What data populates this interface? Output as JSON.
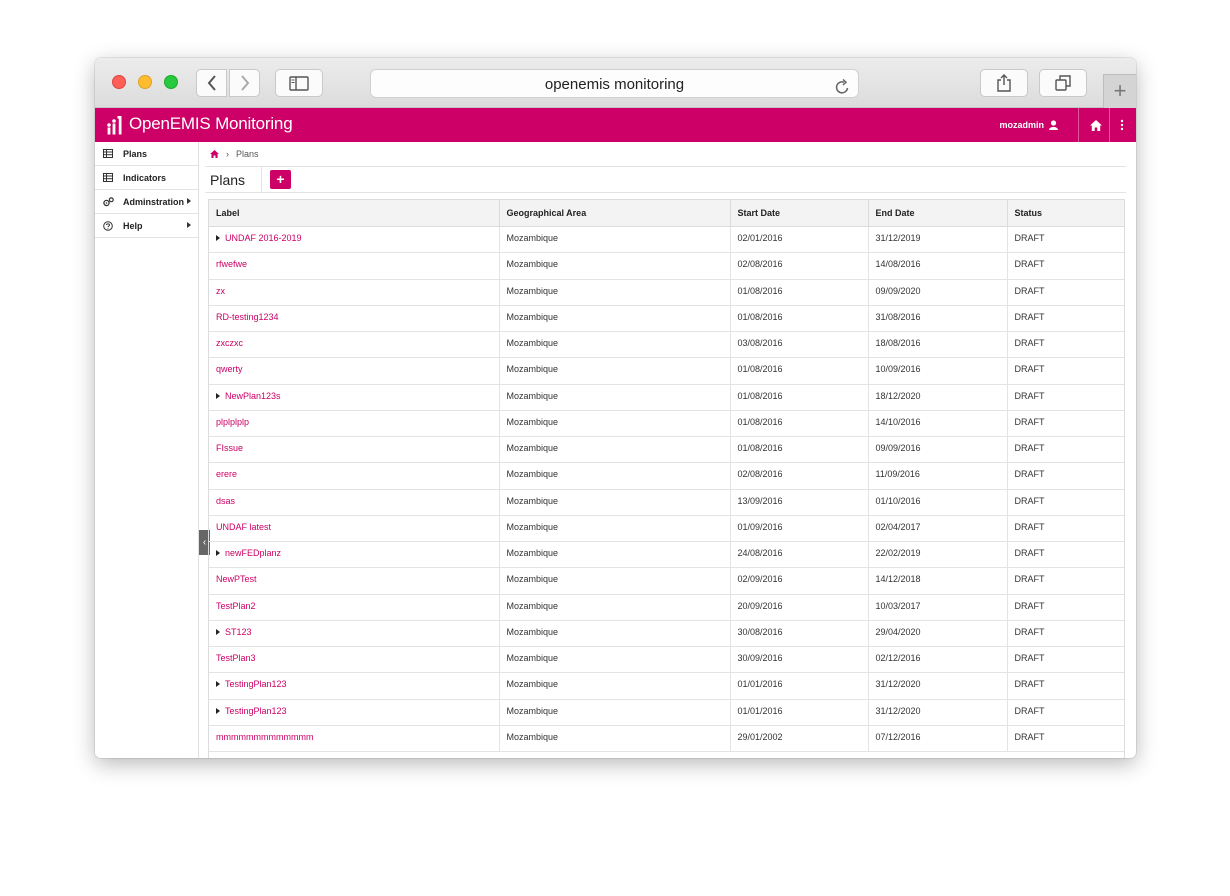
{
  "browser": {
    "url_text": "openemis monitoring",
    "new_tab_glyph": "+"
  },
  "app": {
    "brand": "OpenEMIS Monitoring",
    "user": "mozadmin",
    "accent": "#cc0066"
  },
  "sidebar": {
    "items": [
      {
        "label": "Plans",
        "icon": "table-icon",
        "has_caret": false
      },
      {
        "label": "Indicators",
        "icon": "table-icon",
        "has_caret": false
      },
      {
        "label": "Adminstration",
        "icon": "gears-icon",
        "has_caret": true
      },
      {
        "label": "Help",
        "icon": "help-icon",
        "has_caret": true
      }
    ],
    "collapse_glyph": "‹"
  },
  "breadcrumb": {
    "sep": "›",
    "current": "Plans"
  },
  "page": {
    "title": "Plans",
    "add_label": "+"
  },
  "table": {
    "headers": [
      "Label",
      "Geographical Area",
      "Start Date",
      "End Date",
      "Status"
    ],
    "rows": [
      {
        "label": "UNDAF 2016-2019",
        "expandable": true,
        "area": "Mozambique",
        "start": "02/01/2016",
        "end": "31/12/2019",
        "status": "DRAFT"
      },
      {
        "label": "rfwefwe",
        "expandable": false,
        "area": "Mozambique",
        "start": "02/08/2016",
        "end": "14/08/2016",
        "status": "DRAFT"
      },
      {
        "label": "zx",
        "expandable": false,
        "area": "Mozambique",
        "start": "01/08/2016",
        "end": "09/09/2020",
        "status": "DRAFT"
      },
      {
        "label": "RD-testing1234",
        "expandable": false,
        "area": "Mozambique",
        "start": "01/08/2016",
        "end": "31/08/2016",
        "status": "DRAFT"
      },
      {
        "label": "zxczxc",
        "expandable": false,
        "area": "Mozambique",
        "start": "03/08/2016",
        "end": "18/08/2016",
        "status": "DRAFT"
      },
      {
        "label": "qwerty",
        "expandable": false,
        "area": "Mozambique",
        "start": "01/08/2016",
        "end": "10/09/2016",
        "status": "DRAFT"
      },
      {
        "label": "NewPlan123s",
        "expandable": true,
        "area": "Mozambique",
        "start": "01/08/2016",
        "end": "18/12/2020",
        "status": "DRAFT"
      },
      {
        "label": "plplplplp",
        "expandable": false,
        "area": "Mozambique",
        "start": "01/08/2016",
        "end": "14/10/2016",
        "status": "DRAFT"
      },
      {
        "label": "FIssue",
        "expandable": false,
        "area": "Mozambique",
        "start": "01/08/2016",
        "end": "09/09/2016",
        "status": "DRAFT"
      },
      {
        "label": "erere",
        "expandable": false,
        "area": "Mozambique",
        "start": "02/08/2016",
        "end": "11/09/2016",
        "status": "DRAFT"
      },
      {
        "label": "dsas",
        "expandable": false,
        "area": "Mozambique",
        "start": "13/09/2016",
        "end": "01/10/2016",
        "status": "DRAFT"
      },
      {
        "label": "UNDAF latest",
        "expandable": false,
        "area": "Mozambique",
        "start": "01/09/2016",
        "end": "02/04/2017",
        "status": "DRAFT"
      },
      {
        "label": "newFEDplanz",
        "expandable": true,
        "area": "Mozambique",
        "start": "24/08/2016",
        "end": "22/02/2019",
        "status": "DRAFT"
      },
      {
        "label": "NewPTest",
        "expandable": false,
        "area": "Mozambique",
        "start": "02/09/2016",
        "end": "14/12/2018",
        "status": "DRAFT"
      },
      {
        "label": "TestPlan2",
        "expandable": false,
        "area": "Mozambique",
        "start": "20/09/2016",
        "end": "10/03/2017",
        "status": "DRAFT"
      },
      {
        "label": "ST123",
        "expandable": true,
        "area": "Mozambique",
        "start": "30/08/2016",
        "end": "29/04/2020",
        "status": "DRAFT"
      },
      {
        "label": "TestPlan3",
        "expandable": false,
        "area": "Mozambique",
        "start": "30/09/2016",
        "end": "02/12/2016",
        "status": "DRAFT"
      },
      {
        "label": "TestingPlan123",
        "expandable": true,
        "area": "Mozambique",
        "start": "01/01/2016",
        "end": "31/12/2020",
        "status": "DRAFT"
      },
      {
        "label": "TestingPlan123",
        "expandable": true,
        "area": "Mozambique",
        "start": "01/01/2016",
        "end": "31/12/2020",
        "status": "DRAFT"
      },
      {
        "label": "mmmmmmmmmmmmm",
        "expandable": false,
        "area": "Mozambique",
        "start": "29/01/2002",
        "end": "07/12/2016",
        "status": "DRAFT"
      }
    ]
  }
}
